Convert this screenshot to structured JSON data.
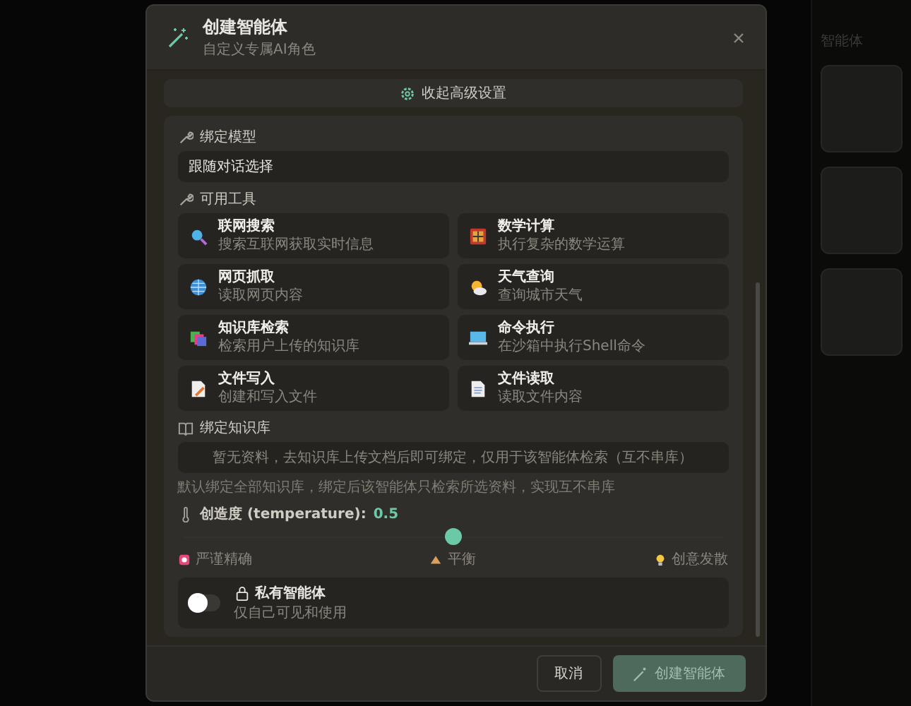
{
  "background": {
    "panel_title": "智能体"
  },
  "header": {
    "title": "创建智能体",
    "subtitle": "自定义专属AI角色"
  },
  "collapse_button": "收起高级设置",
  "model": {
    "label": "绑定模型",
    "value": "跟随对话选择"
  },
  "tools": {
    "label": "可用工具",
    "items": [
      {
        "kind": "search",
        "name": "联网搜索",
        "description": "搜索互联网获取实时信息"
      },
      {
        "kind": "calculator",
        "name": "数学计算",
        "description": "执行复杂的数学运算"
      },
      {
        "kind": "globe",
        "name": "网页抓取",
        "description": "读取网页内容"
      },
      {
        "kind": "weather",
        "name": "天气查询",
        "description": "查询城市天气"
      },
      {
        "kind": "books",
        "name": "知识库检索",
        "description": "检索用户上传的知识库"
      },
      {
        "kind": "terminal",
        "name": "命令执行",
        "description": "在沙箱中执行Shell命令"
      },
      {
        "kind": "file-write",
        "name": "文件写入",
        "description": "创建和写入文件"
      },
      {
        "kind": "file-read",
        "name": "文件读取",
        "description": "读取文件内容"
      }
    ]
  },
  "knowledge": {
    "label": "绑定知识库",
    "empty": "暂无资料，去知识库上传文档后即可绑定，仅用于该智能体检索（互不串库）",
    "note": "默认绑定全部知识库，绑定后该智能体只检索所选资料，实现互不串库"
  },
  "temperature": {
    "label": "创造度 (temperature):",
    "reading": "0.5",
    "level": 0.5,
    "scale": [
      {
        "kind": "precise",
        "label": "严谨精确"
      },
      {
        "kind": "balanced",
        "label": "平衡"
      },
      {
        "kind": "creative",
        "label": "创意发散"
      }
    ]
  },
  "private": {
    "title": "私有智能体",
    "description": "仅自己可见和使用",
    "on": false
  },
  "footer": {
    "cancel": "取消",
    "create": "创建智能体",
    "create_disabled": true
  }
}
